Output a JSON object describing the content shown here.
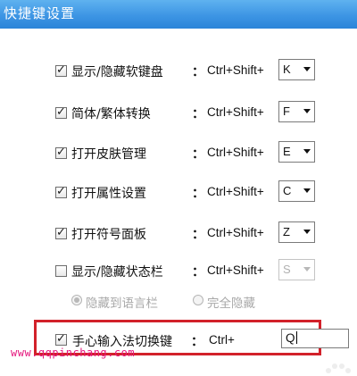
{
  "window": {
    "title": "快捷键设置"
  },
  "shortcuts": [
    {
      "label": "显示/隐藏软键盘",
      "checked": true,
      "modifier": "Ctrl+Shift+",
      "key": "K",
      "enabled": true
    },
    {
      "label": "简体/繁体转换",
      "checked": true,
      "modifier": "Ctrl+Shift+",
      "key": "F",
      "enabled": true
    },
    {
      "label": "打开皮肤管理",
      "checked": true,
      "modifier": "Ctrl+Shift+",
      "key": "E",
      "enabled": true
    },
    {
      "label": "打开属性设置",
      "checked": true,
      "modifier": "Ctrl+Shift+",
      "key": "C",
      "enabled": true
    },
    {
      "label": "打开符号面板",
      "checked": true,
      "modifier": "Ctrl+Shift+",
      "key": "Z",
      "enabled": true
    },
    {
      "label": "显示/隐藏状态栏",
      "checked": false,
      "modifier": "Ctrl+Shift+",
      "key": "S",
      "enabled": false
    }
  ],
  "colon": "：",
  "status_bar_options": [
    {
      "label": "隐藏到语言栏",
      "selected": true
    },
    {
      "label": "完全隐藏",
      "selected": false
    }
  ],
  "handwriting": {
    "label": "手心输入法切换键",
    "checked": true,
    "modifier": "Ctrl+",
    "key_value": "Q"
  },
  "watermark": "www.qqpinchang.com",
  "colors": {
    "titlebar": "#3d95e4",
    "highlight_border": "#d2212a",
    "watermark": "#e5187e"
  }
}
